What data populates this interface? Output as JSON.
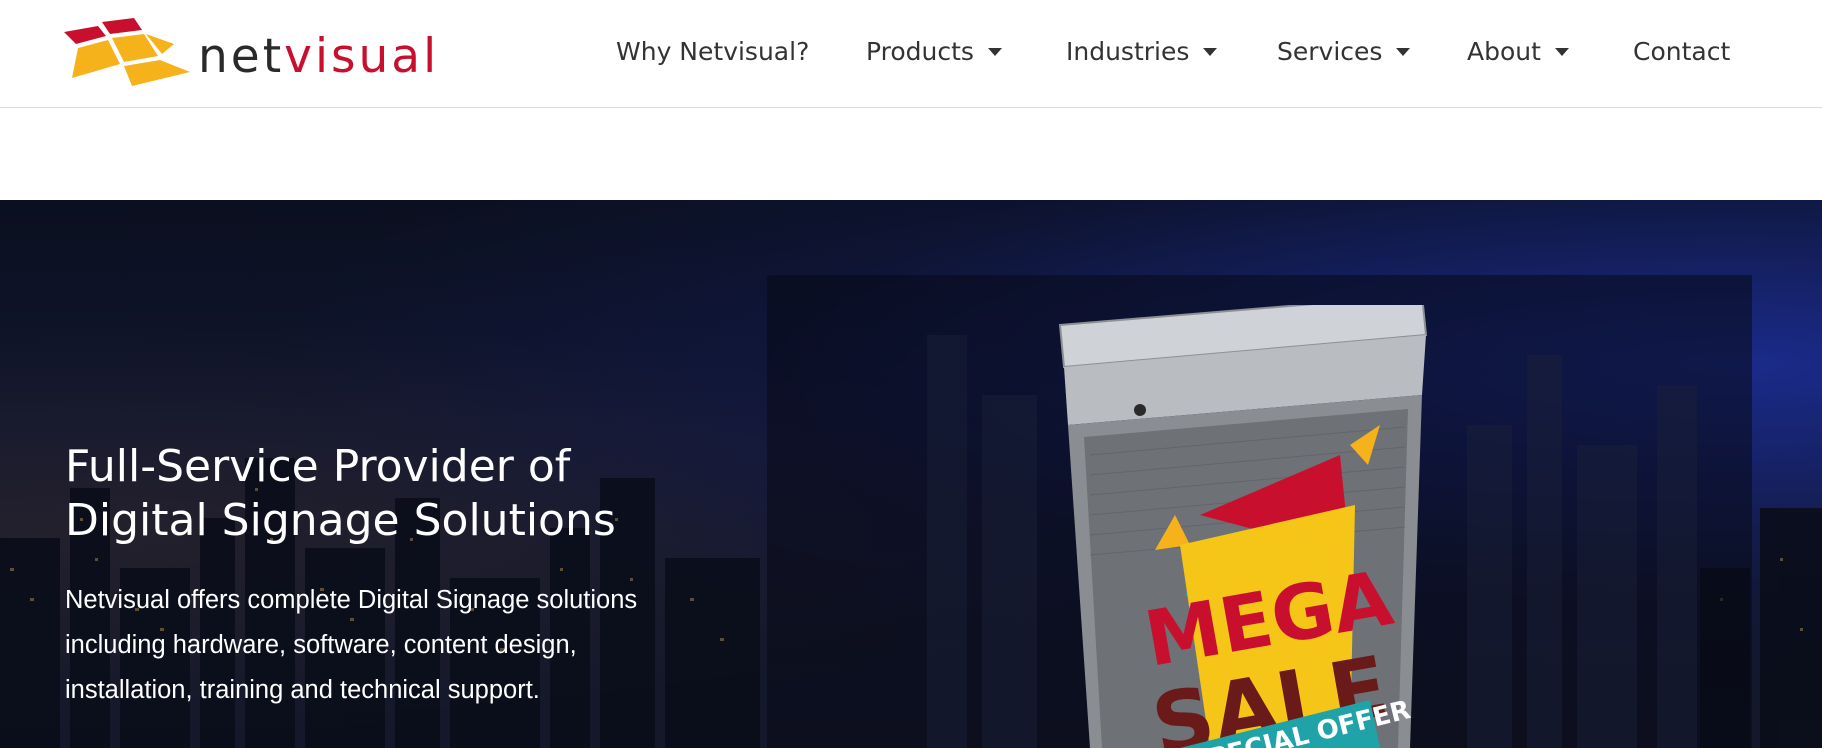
{
  "brand": {
    "logo_text_net": "net",
    "logo_text_visual": "visual",
    "colors": {
      "red": "#c8102e",
      "orange": "#f5b21b",
      "dark": "#2a2a2a"
    }
  },
  "nav": {
    "items": [
      {
        "label": "Why Netvisual?",
        "has_dropdown": false
      },
      {
        "label": "Products",
        "has_dropdown": true
      },
      {
        "label": "Industries",
        "has_dropdown": true
      },
      {
        "label": "Services",
        "has_dropdown": true
      },
      {
        "label": "About",
        "has_dropdown": true
      },
      {
        "label": "Contact",
        "has_dropdown": false
      }
    ]
  },
  "hero": {
    "title_line1": "Full-Service Provider of",
    "title_line2": "Digital Signage Solutions",
    "desc_line1": "Netvisual offers complete Digital Signage solutions",
    "desc_line2": "including hardware, software, content design,",
    "desc_line3": "installation, training and technical support.",
    "poster": {
      "line1": "MEGA",
      "line2": "SALE",
      "banner": "SPECIAL OFFER"
    }
  }
}
